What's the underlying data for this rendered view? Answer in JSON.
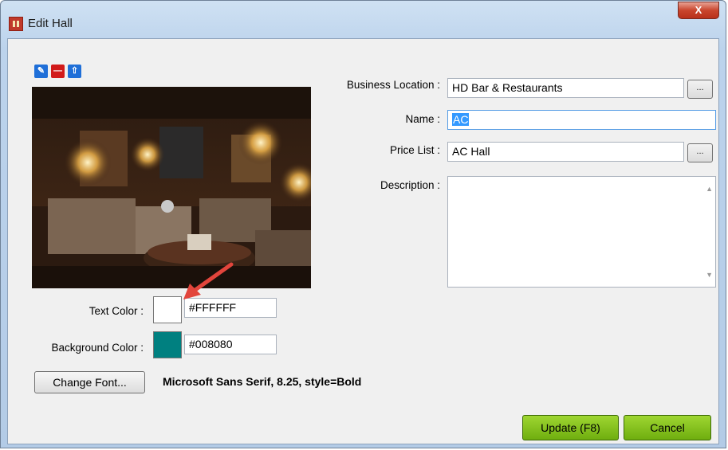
{
  "window": {
    "title": "Edit Hall",
    "close_label": "X"
  },
  "toolbar": {
    "edit_icon": "pencil-icon",
    "remove_icon": "minus-icon",
    "upload_icon": "upload-icon"
  },
  "form": {
    "business_location_label": "Business Location :",
    "business_location_value": "HD Bar & Restaurants",
    "name_label": "Name :",
    "name_value": "AC",
    "price_list_label": "Price List :",
    "price_list_value": "AC Hall",
    "description_label": "Description :",
    "description_value": "",
    "browse_label": "...",
    "text_color_label": "Text Color :",
    "text_color_value": "#FFFFFF",
    "background_color_label": "Background Color :",
    "background_color_value": "#008080",
    "change_font_label": "Change Font...",
    "font_description": "Microsoft Sans Serif, 8.25, style=Bold"
  },
  "actions": {
    "update_label": "Update (F8)",
    "cancel_label": "Cancel"
  },
  "colors": {
    "text_swatch": "#FFFFFF",
    "background_swatch": "#008080",
    "accent_green": "#7dbb1a",
    "arrow": "#e2453c"
  }
}
